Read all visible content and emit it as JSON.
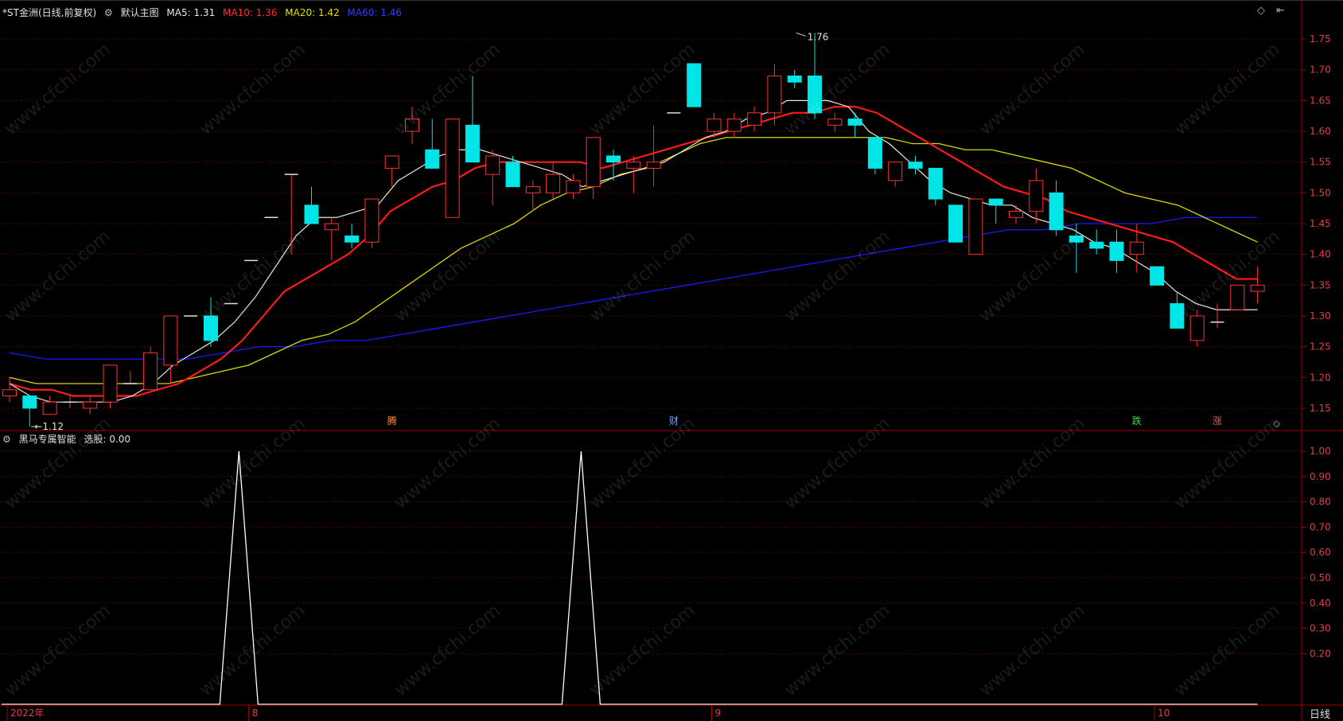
{
  "header": {
    "stock": "*ST金洲(日线,前复权)",
    "main_indicator": "默认主图",
    "ma5_label": "MA5:",
    "ma5_value": "1.31",
    "ma10_label": "MA10:",
    "ma10_value": "1.36",
    "ma20_label": "MA20:",
    "ma20_value": "1.42",
    "ma60_label": "MA60:",
    "ma60_value": "1.46"
  },
  "sub_header": {
    "indicator": "黑马专属智能",
    "label": "选股:",
    "value": "0.00"
  },
  "colors": {
    "up": "#ff3232",
    "down": "#00e6e6",
    "ma5": "#e8e8e8",
    "ma10": "#ff1a1a",
    "ma20": "#d9d900",
    "ma60": "#1a1aff",
    "axis": "#a00000",
    "grid": "#5a0000",
    "signal": "#ffffff"
  },
  "price_axis": [
    "1.75",
    "1.70",
    "1.65",
    "1.60",
    "1.55",
    "1.50",
    "1.45",
    "1.40",
    "1.35",
    "1.30",
    "1.25",
    "1.20",
    "1.15"
  ],
  "indicator_axis": [
    "1.00",
    "0.90",
    "0.80",
    "0.70",
    "0.60",
    "0.50",
    "0.40",
    "0.30",
    "0.20"
  ],
  "date_axis": [
    {
      "label": "2022年",
      "bar": 0
    },
    {
      "label": "8",
      "bar": 12
    },
    {
      "label": "9",
      "bar": 35
    },
    {
      "label": "10",
      "bar": 57
    }
  ],
  "annotations": {
    "high_label": "1.76",
    "low_label": "1.12",
    "high_bar": 39,
    "low_bar": 1
  },
  "event_markers": [
    {
      "label": "腾",
      "bar": 19,
      "color": "#ff8c3c"
    },
    {
      "label": "财",
      "bar": 33,
      "color": "#6aa0ff"
    },
    {
      "label": "跌",
      "bar": 56,
      "color": "#4cd24c"
    },
    {
      "label": "涨",
      "bar": 60,
      "color": "#ff5050"
    }
  ],
  "period_label": "日线",
  "watermark_text": "www.cfchi.com",
  "candles": [
    {
      "o": 1.17,
      "h": 1.2,
      "l": 1.16,
      "c": 1.18
    },
    {
      "o": 1.17,
      "h": 1.17,
      "l": 1.12,
      "c": 1.15
    },
    {
      "o": 1.14,
      "h": 1.17,
      "l": 1.14,
      "c": 1.16
    },
    {
      "o": 1.16,
      "h": 1.17,
      "l": 1.15,
      "c": 1.16
    },
    {
      "o": 1.15,
      "h": 1.17,
      "l": 1.14,
      "c": 1.16
    },
    {
      "o": 1.16,
      "h": 1.22,
      "l": 1.15,
      "c": 1.22
    },
    {
      "o": 1.19,
      "h": 1.21,
      "l": 1.19,
      "c": 1.19
    },
    {
      "o": 1.18,
      "h": 1.25,
      "l": 1.18,
      "c": 1.24
    },
    {
      "o": 1.22,
      "h": 1.3,
      "l": 1.19,
      "c": 1.3
    },
    {
      "o": 1.3,
      "h": 1.3,
      "l": 1.3,
      "c": 1.3
    },
    {
      "o": 1.3,
      "h": 1.33,
      "l": 1.25,
      "c": 1.26
    },
    {
      "o": 1.32,
      "h": 1.32,
      "l": 1.32,
      "c": 1.32
    },
    {
      "o": 1.39,
      "h": 1.39,
      "l": 1.39,
      "c": 1.39
    },
    {
      "o": 1.46,
      "h": 1.46,
      "l": 1.46,
      "c": 1.46
    },
    {
      "o": 1.53,
      "h": 1.53,
      "l": 1.4,
      "c": 1.53
    },
    {
      "o": 1.48,
      "h": 1.51,
      "l": 1.45,
      "c": 1.45
    },
    {
      "o": 1.44,
      "h": 1.46,
      "l": 1.39,
      "c": 1.45
    },
    {
      "o": 1.43,
      "h": 1.45,
      "l": 1.41,
      "c": 1.42
    },
    {
      "o": 1.42,
      "h": 1.47,
      "l": 1.41,
      "c": 1.49
    },
    {
      "o": 1.54,
      "h": 1.56,
      "l": 1.51,
      "c": 1.56
    },
    {
      "o": 1.6,
      "h": 1.64,
      "l": 1.58,
      "c": 1.62
    },
    {
      "o": 1.57,
      "h": 1.62,
      "l": 1.54,
      "c": 1.54
    },
    {
      "o": 1.46,
      "h": 1.62,
      "l": 1.46,
      "c": 1.62
    },
    {
      "o": 1.61,
      "h": 1.69,
      "l": 1.55,
      "c": 1.55
    },
    {
      "o": 1.53,
      "h": 1.57,
      "l": 1.48,
      "c": 1.56
    },
    {
      "o": 1.55,
      "h": 1.56,
      "l": 1.51,
      "c": 1.51
    },
    {
      "o": 1.5,
      "h": 1.52,
      "l": 1.47,
      "c": 1.51
    },
    {
      "o": 1.5,
      "h": 1.55,
      "l": 1.49,
      "c": 1.53
    },
    {
      "o": 1.5,
      "h": 1.53,
      "l": 1.49,
      "c": 1.52
    },
    {
      "o": 1.51,
      "h": 1.59,
      "l": 1.49,
      "c": 1.59
    },
    {
      "o": 1.56,
      "h": 1.57,
      "l": 1.52,
      "c": 1.55
    },
    {
      "o": 1.54,
      "h": 1.56,
      "l": 1.5,
      "c": 1.55
    },
    {
      "o": 1.54,
      "h": 1.61,
      "l": 1.51,
      "c": 1.55
    },
    {
      "o": 1.63,
      "h": 1.63,
      "l": 1.63,
      "c": 1.63
    },
    {
      "o": 1.71,
      "h": 1.71,
      "l": 1.64,
      "c": 1.64
    },
    {
      "o": 1.6,
      "h": 1.63,
      "l": 1.59,
      "c": 1.62
    },
    {
      "o": 1.6,
      "h": 1.63,
      "l": 1.59,
      "c": 1.62
    },
    {
      "o": 1.61,
      "h": 1.64,
      "l": 1.6,
      "c": 1.63
    },
    {
      "o": 1.63,
      "h": 1.71,
      "l": 1.61,
      "c": 1.69
    },
    {
      "o": 1.69,
      "h": 1.7,
      "l": 1.67,
      "c": 1.68
    },
    {
      "o": 1.69,
      "h": 1.76,
      "l": 1.62,
      "c": 1.63
    },
    {
      "o": 1.61,
      "h": 1.63,
      "l": 1.6,
      "c": 1.62
    },
    {
      "o": 1.62,
      "h": 1.63,
      "l": 1.59,
      "c": 1.61
    },
    {
      "o": 1.59,
      "h": 1.59,
      "l": 1.53,
      "c": 1.54
    },
    {
      "o": 1.52,
      "h": 1.55,
      "l": 1.51,
      "c": 1.55
    },
    {
      "o": 1.55,
      "h": 1.56,
      "l": 1.53,
      "c": 1.54
    },
    {
      "o": 1.54,
      "h": 1.54,
      "l": 1.48,
      "c": 1.49
    },
    {
      "o": 1.48,
      "h": 1.48,
      "l": 1.42,
      "c": 1.42
    },
    {
      "o": 1.4,
      "h": 1.49,
      "l": 1.4,
      "c": 1.49
    },
    {
      "o": 1.49,
      "h": 1.49,
      "l": 1.45,
      "c": 1.48
    },
    {
      "o": 1.46,
      "h": 1.48,
      "l": 1.45,
      "c": 1.47
    },
    {
      "o": 1.47,
      "h": 1.54,
      "l": 1.45,
      "c": 1.52
    },
    {
      "o": 1.5,
      "h": 1.52,
      "l": 1.43,
      "c": 1.44
    },
    {
      "o": 1.43,
      "h": 1.45,
      "l": 1.37,
      "c": 1.42
    },
    {
      "o": 1.42,
      "h": 1.44,
      "l": 1.4,
      "c": 1.41
    },
    {
      "o": 1.42,
      "h": 1.44,
      "l": 1.37,
      "c": 1.39
    },
    {
      "o": 1.4,
      "h": 1.45,
      "l": 1.37,
      "c": 1.42
    },
    {
      "o": 1.38,
      "h": 1.38,
      "l": 1.35,
      "c": 1.35
    },
    {
      "o": 1.32,
      "h": 1.34,
      "l": 1.28,
      "c": 1.28
    },
    {
      "o": 1.26,
      "h": 1.31,
      "l": 1.25,
      "c": 1.3
    },
    {
      "o": 1.29,
      "h": 1.32,
      "l": 1.28,
      "c": 1.29
    },
    {
      "o": 1.31,
      "h": 1.35,
      "l": 1.31,
      "c": 1.35
    },
    {
      "o": 1.34,
      "h": 1.38,
      "l": 1.32,
      "c": 1.35
    }
  ],
  "ma5": [
    1.19,
    1.17,
    1.16,
    1.16,
    1.16,
    1.16,
    1.17,
    1.19,
    1.22,
    1.24,
    1.26,
    1.29,
    1.33,
    1.38,
    1.43,
    1.46,
    1.46,
    1.47,
    1.48,
    1.52,
    1.54,
    1.56,
    1.57,
    1.57,
    1.56,
    1.55,
    1.54,
    1.53,
    1.51,
    1.52,
    1.53,
    1.54,
    1.55,
    1.57,
    1.59,
    1.6,
    1.62,
    1.63,
    1.65,
    1.65,
    1.65,
    1.64,
    1.6,
    1.58,
    1.55,
    1.52,
    1.5,
    1.49,
    1.48,
    1.48,
    1.46,
    1.45,
    1.44,
    1.42,
    1.41,
    1.39,
    1.37,
    1.34,
    1.32,
    1.31,
    1.31,
    1.31
  ],
  "ma10": [
    1.19,
    1.18,
    1.18,
    1.17,
    1.17,
    1.17,
    1.17,
    1.18,
    1.19,
    1.21,
    1.23,
    1.26,
    1.3,
    1.34,
    1.36,
    1.38,
    1.4,
    1.43,
    1.47,
    1.49,
    1.51,
    1.52,
    1.54,
    1.55,
    1.55,
    1.55,
    1.55,
    1.55,
    1.54,
    1.55,
    1.56,
    1.57,
    1.58,
    1.59,
    1.6,
    1.61,
    1.62,
    1.63,
    1.63,
    1.64,
    1.64,
    1.63,
    1.61,
    1.59,
    1.57,
    1.55,
    1.53,
    1.51,
    1.5,
    1.49,
    1.47,
    1.46,
    1.45,
    1.44,
    1.43,
    1.42,
    1.4,
    1.38,
    1.36,
    1.36
  ],
  "ma20": [
    1.2,
    1.19,
    1.19,
    1.19,
    1.19,
    1.19,
    1.19,
    1.2,
    1.21,
    1.22,
    1.24,
    1.26,
    1.27,
    1.29,
    1.32,
    1.35,
    1.38,
    1.41,
    1.43,
    1.45,
    1.48,
    1.5,
    1.51,
    1.53,
    1.54,
    1.56,
    1.58,
    1.59,
    1.59,
    1.59,
    1.59,
    1.59,
    1.59,
    1.59,
    1.58,
    1.58,
    1.57,
    1.57,
    1.56,
    1.55,
    1.54,
    1.52,
    1.5,
    1.49,
    1.48,
    1.46,
    1.44,
    1.42
  ],
  "ma60": [
    1.24,
    1.23,
    1.23,
    1.23,
    1.23,
    1.23,
    1.24,
    1.25,
    1.25,
    1.26,
    1.26,
    1.27,
    1.28,
    1.29,
    1.3,
    1.31,
    1.32,
    1.33,
    1.34,
    1.35,
    1.36,
    1.37,
    1.38,
    1.39,
    1.4,
    1.41,
    1.42,
    1.43,
    1.44,
    1.44,
    1.45,
    1.45,
    1.45,
    1.46,
    1.46,
    1.46
  ],
  "signal_peaks": [
    11,
    28
  ]
}
